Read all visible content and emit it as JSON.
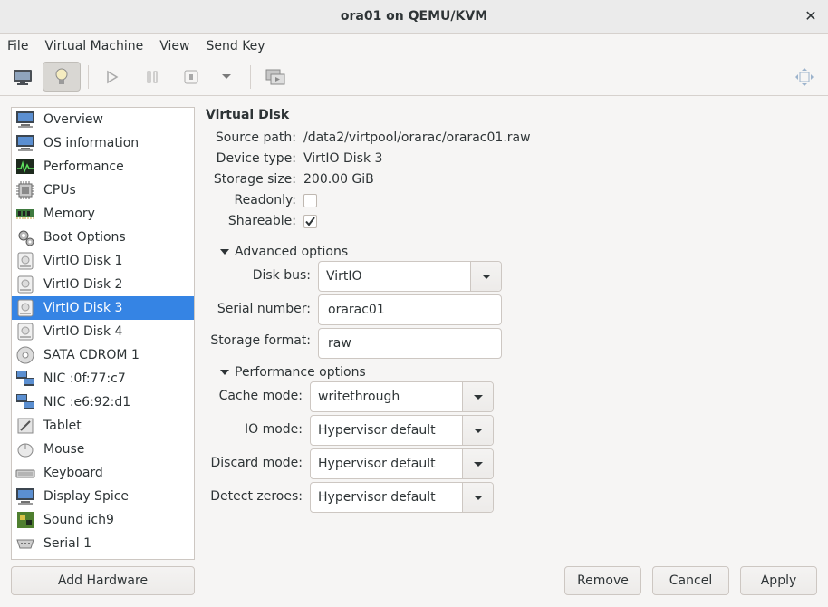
{
  "window": {
    "title": "ora01 on QEMU/KVM"
  },
  "menu": [
    "File",
    "Virtual Machine",
    "View",
    "Send Key"
  ],
  "toolbar": {
    "icons": [
      "console-icon",
      "details-lightbulb-icon",
      "run-icon",
      "pause-icon",
      "shutdown-icon",
      "chevron-down-icon",
      "snapshots-icon",
      "fullscreen-icon"
    ]
  },
  "hardware_list": [
    {
      "label": "Overview",
      "icon": "monitor-icon"
    },
    {
      "label": "OS information",
      "icon": "monitor-icon"
    },
    {
      "label": "Performance",
      "icon": "performance-icon"
    },
    {
      "label": "CPUs",
      "icon": "cpu-icon"
    },
    {
      "label": "Memory",
      "icon": "memory-icon"
    },
    {
      "label": "Boot Options",
      "icon": "gear-icon"
    },
    {
      "label": "VirtIO Disk 1",
      "icon": "disk-icon"
    },
    {
      "label": "VirtIO Disk 2",
      "icon": "disk-icon"
    },
    {
      "label": "VirtIO Disk 3",
      "icon": "disk-icon",
      "selected": true
    },
    {
      "label": "VirtIO Disk 4",
      "icon": "disk-icon"
    },
    {
      "label": "SATA CDROM 1",
      "icon": "cdrom-icon"
    },
    {
      "label": "NIC :0f:77:c7",
      "icon": "network-icon"
    },
    {
      "label": "NIC :e6:92:d1",
      "icon": "network-icon"
    },
    {
      "label": "Tablet",
      "icon": "tablet-icon"
    },
    {
      "label": "Mouse",
      "icon": "mouse-icon"
    },
    {
      "label": "Keyboard",
      "icon": "keyboard-icon"
    },
    {
      "label": "Display Spice",
      "icon": "monitor-icon"
    },
    {
      "label": "Sound ich9",
      "icon": "sound-icon"
    },
    {
      "label": "Serial 1",
      "icon": "serial-icon"
    }
  ],
  "add_hardware_label": "Add Hardware",
  "disk": {
    "title": "Virtual Disk",
    "source_path_label": "Source path:",
    "source_path": "/data2/virtpool/orarac/orarac01.raw",
    "device_type_label": "Device type:",
    "device_type": "VirtIO Disk 3",
    "storage_size_label": "Storage size:",
    "storage_size": "200.00 GiB",
    "readonly_label": "Readonly:",
    "readonly": false,
    "shareable_label": "Shareable:",
    "shareable": true
  },
  "advanced": {
    "label": "Advanced options",
    "disk_bus_label": "Disk bus:",
    "disk_bus": "VirtIO",
    "serial_label": "Serial number:",
    "serial": "orarac01",
    "format_label": "Storage format:",
    "format": "raw"
  },
  "performance": {
    "label": "Performance options",
    "cache_label": "Cache mode:",
    "cache": "writethrough",
    "io_label": "IO mode:",
    "io": "Hypervisor default",
    "discard_label": "Discard mode:",
    "discard": "Hypervisor default",
    "zeroes_label": "Detect zeroes:",
    "zeroes": "Hypervisor default"
  },
  "buttons": {
    "remove": "Remove",
    "cancel": "Cancel",
    "apply": "Apply"
  },
  "colors": {
    "selection": "#3584e4",
    "background": "#f6f5f4"
  }
}
